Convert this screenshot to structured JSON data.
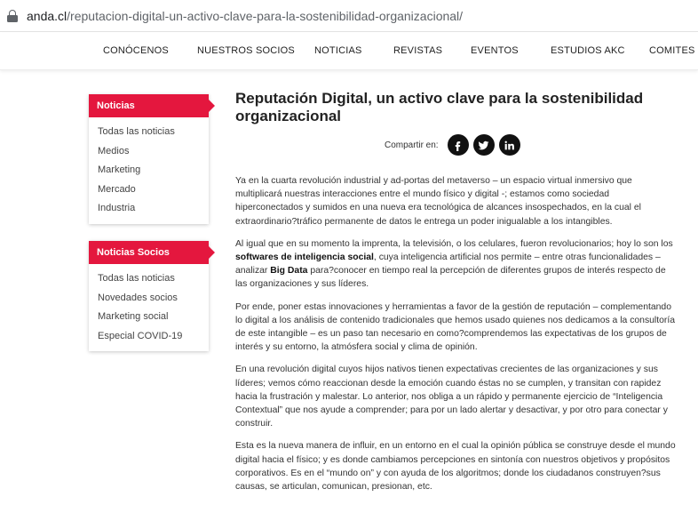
{
  "browser": {
    "url_domain": "anda.cl",
    "url_path": "/reputacion-digital-un-activo-clave-para-la-sostenibilidad-organizacional/"
  },
  "nav": {
    "items": [
      "CONÓCENOS",
      "NUESTROS SOCIOS",
      "NOTICIAS",
      "REVISTAS",
      "EVENTOS",
      "ESTUDIOS AKC",
      "COMITES DE"
    ]
  },
  "sidebar": {
    "noticias": {
      "title": "Noticias",
      "links": [
        "Todas las noticias",
        "Medios",
        "Marketing",
        "Mercado",
        "Industria"
      ]
    },
    "socios": {
      "title": "Noticias Socios",
      "links": [
        "Todas las noticias",
        "Novedades socios",
        "Marketing social",
        "Especial COVID-19"
      ]
    }
  },
  "article": {
    "title": "Reputación Digital, un activo clave para la sostenibilidad organizacional",
    "share_label": "Compartir en:",
    "social": [
      "facebook-icon",
      "twitter-icon",
      "linkedin-icon"
    ],
    "p1": "Ya en la cuarta revolución industrial y ad-portas del metaverso – un espacio virtual inmersivo que multiplicará nuestras interacciones entre el mundo físico y digital -; estamos como sociedad hiperconectados y sumidos en una nueva era tecnológica de alcances insospechados, en la cual el extraordinario?tráfico permanente de datos le entrega un poder inigualable a los intangibles.",
    "p2a": "Al igual que en su momento la imprenta, la televisión, o los celulares, fueron revolucionarios; hoy lo son los ",
    "p2b": "softwares de inteligencia social",
    "p2c": ", cuya inteligencia artificial nos permite – entre otras funcionalidades – analizar ",
    "p2d": "Big Data",
    "p2e": " para?conocer en tiempo real la percepción de diferentes grupos de interés respecto de las organizaciones y sus líderes.",
    "p3": "Por ende, poner estas innovaciones y herramientas a favor de la gestión de reputación – complementando lo digital a los análisis de contenido tradicionales que hemos usado quienes nos dedicamos a la consultoría de este intangible – es un paso tan necesario en como?comprendemos las expectativas de los grupos de interés y su entorno, la atmósfera social y clima de opinión.",
    "p4": "En una revolución digital cuyos hijos nativos tienen expectativas crecientes de las organizaciones y sus líderes; vemos cómo reaccionan desde la emoción cuando éstas no se cumplen, y transitan con rapidez hacia la frustración y malestar. Lo anterior, nos obliga a un rápido y permanente ejercicio de “Inteligencia Contextual” que nos ayude a comprender; para por un lado alertar y desactivar, y por otro para conectar y construir.",
    "p5": "Esta es la nueva manera de influir, en un entorno en el cual la opinión pública se construye desde el mundo digital hacia el físico; y es donde cambiamos percepciones en sintonía con nuestros objetivos y propósitos corporativos. Es en el “mundo on” y con ayuda de los algoritmos; donde los ciudadanos construyen?sus causas, se articulan, comunican, presionan, etc."
  },
  "colors": {
    "accent": "#e4173e"
  }
}
